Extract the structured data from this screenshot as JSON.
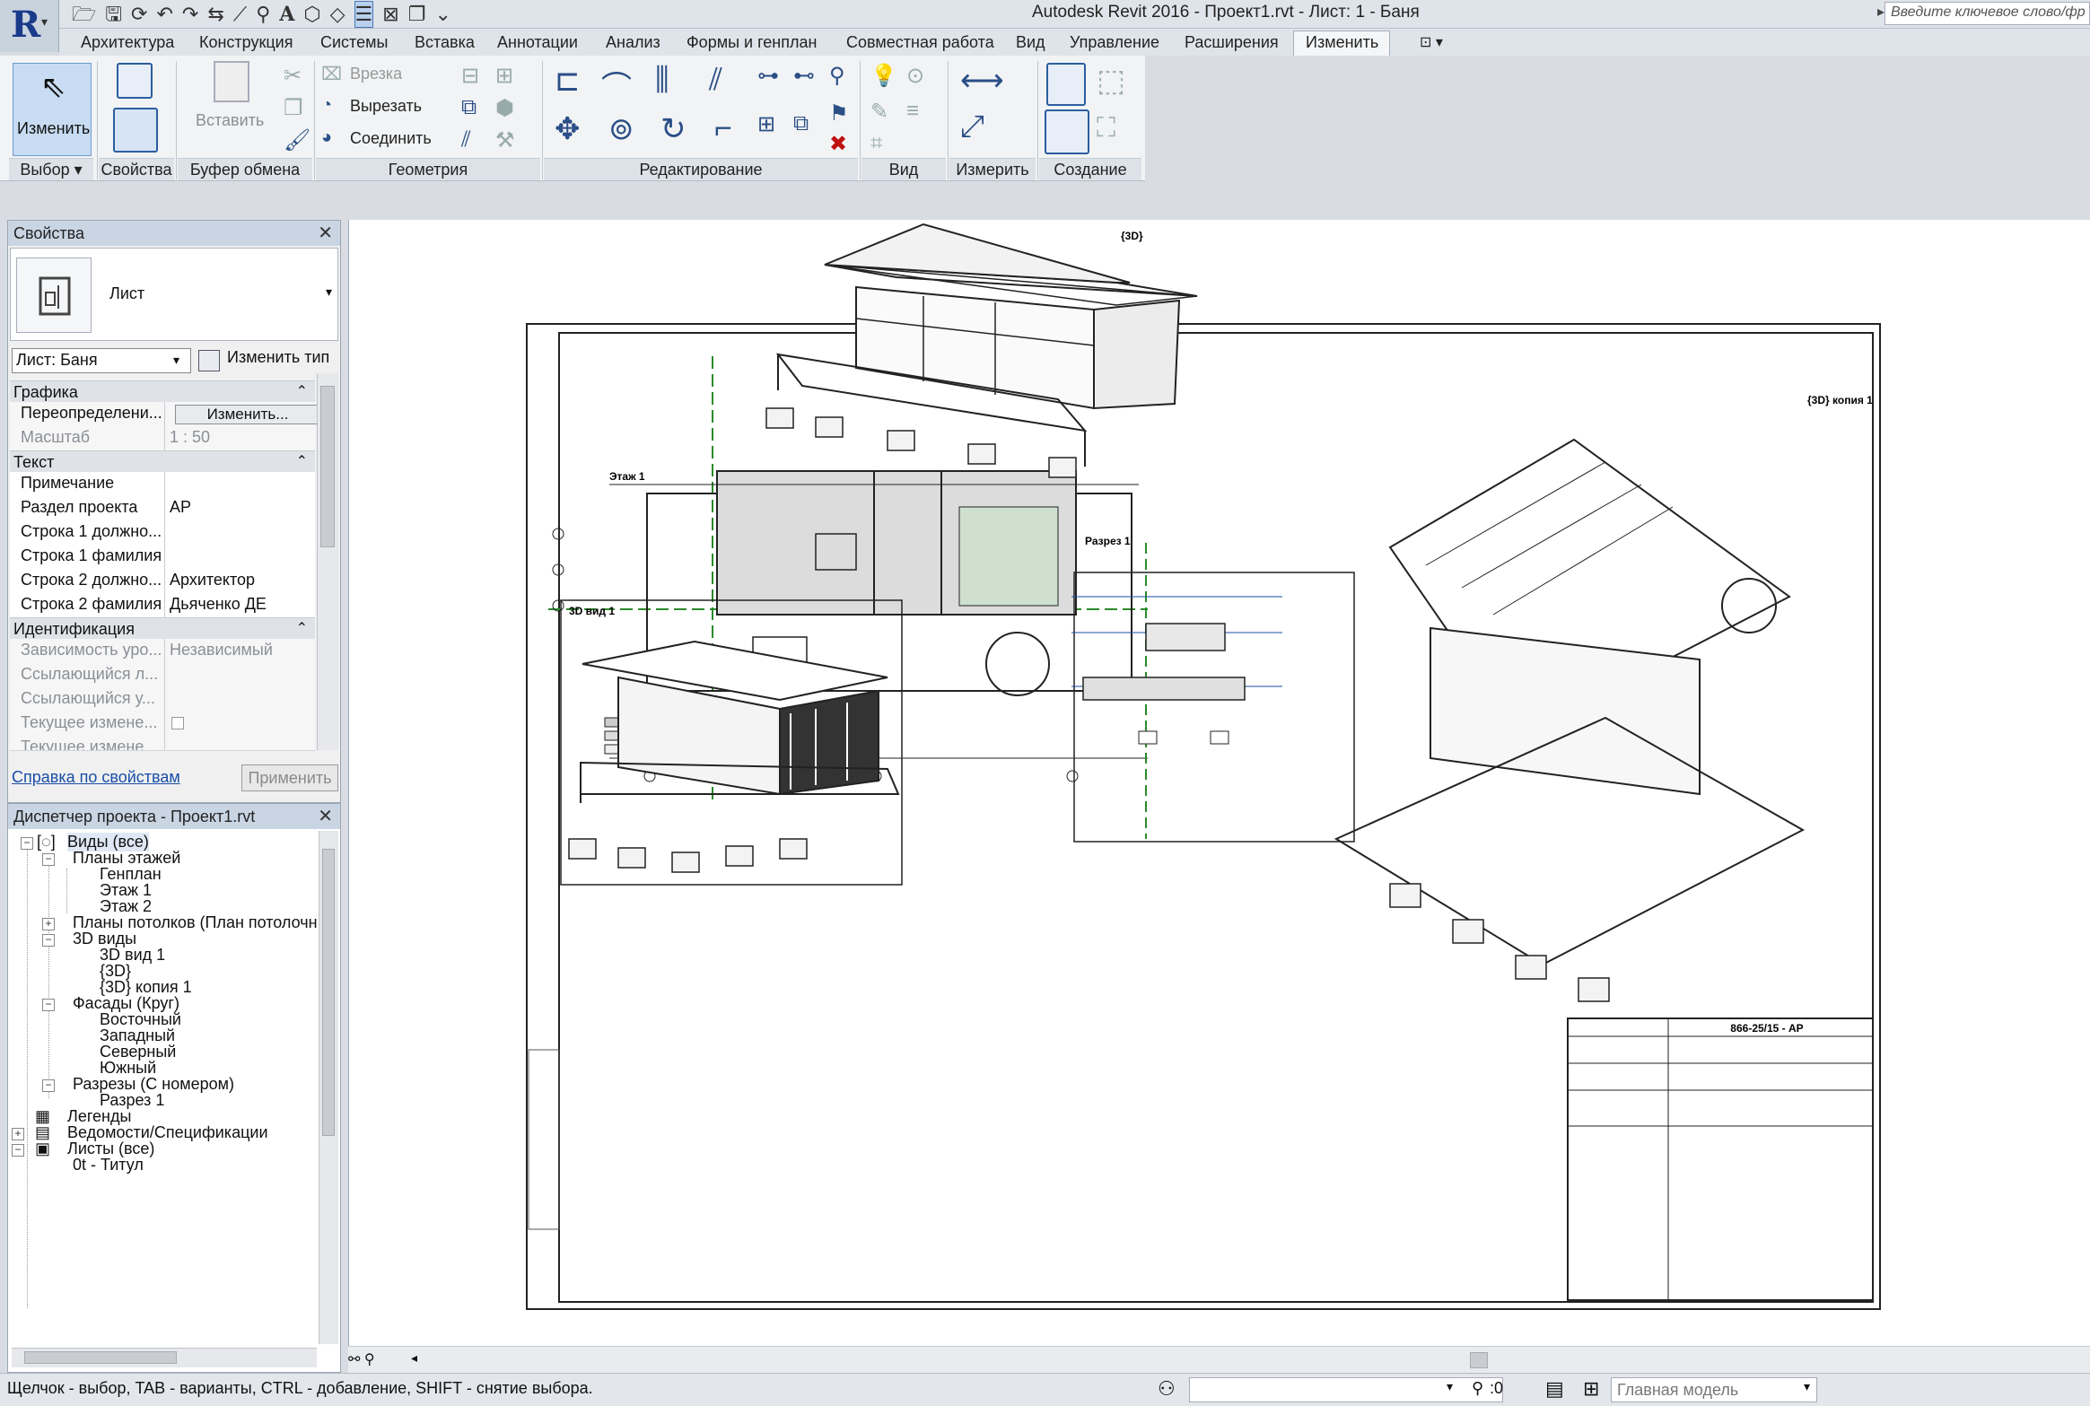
{
  "window": {
    "title": "Autodesk Revit 2016 -    Проект1.rvt - Лист: 1 - Баня"
  },
  "search": {
    "placeholder": "Введите ключевое слово/фр"
  },
  "tabs": [
    "Архитектура",
    "Конструкция",
    "Системы",
    "Вставка",
    "Аннотации",
    "Анализ",
    "Формы и генплан",
    "Совместная работа",
    "Вид",
    "Управление",
    "Расширения",
    "Изменить"
  ],
  "ribbon": {
    "modify_label": "Изменить",
    "paste_label": "Вставить",
    "cut_label": "Врезка",
    "cut2_label": "Вырезать",
    "join_label": "Соединить",
    "panels": [
      "Выбор",
      "Свойства",
      "Буфер обмена",
      "Геометрия",
      "Редактирование",
      "Вид",
      "Измерить",
      "Создание"
    ]
  },
  "properties": {
    "title": "Свойства",
    "type_name": "Лист",
    "instance_selector": "Лист: Баня",
    "edit_type": "Изменить тип",
    "groups": [
      "Графика",
      "Текст",
      "Идентификация"
    ],
    "graphics": [
      {
        "name": "Переопределени...",
        "value": "Изменить..."
      },
      {
        "name": "Масштаб",
        "value": "1 : 50"
      }
    ],
    "text": [
      {
        "name": "Примечание",
        "value": ""
      },
      {
        "name": "Раздел проекта",
        "value": "АР"
      },
      {
        "name": "Строка 1 должно...",
        "value": ""
      },
      {
        "name": "Строка 1 фамилия",
        "value": ""
      },
      {
        "name": "Строка 2 должно...",
        "value": "Архитектор"
      },
      {
        "name": "Строка 2 фамилия",
        "value": "Дьяченко ДЕ"
      }
    ],
    "identity": [
      {
        "name": "Зависимость уро...",
        "value": "Независимый"
      },
      {
        "name": "Ссылающийся л...",
        "value": ""
      },
      {
        "name": "Ссылающийся у...",
        "value": ""
      },
      {
        "name": "Текущее измене...",
        "value": ""
      },
      {
        "name": "Текущее измене...",
        "value": ""
      }
    ],
    "help_link": "Справка по свойствам",
    "apply": "Применить"
  },
  "browser": {
    "title": "Диспетчер проекта - Проект1.rvt",
    "items": [
      "Виды (все)",
      "Планы этажей",
      "Генплан",
      "Этаж 1",
      "Этаж 2",
      "Планы потолков (План потолочн",
      "3D виды",
      "3D вид 1",
      "{3D}",
      "{3D} копия 1",
      "Фасады (Круг)",
      "Восточный",
      "Западный",
      "Северный",
      "Южный",
      "Разрезы (С номером)",
      "Разрез 1",
      "Легенды",
      "Ведомости/Спецификации",
      "Листы (все)",
      "0t - Титул"
    ]
  },
  "sheet": {
    "labels": [
      "Этаж 1",
      "{3D}",
      "{3D} копия 1",
      "Разрез 1",
      "3D вид 1"
    ],
    "stamp_code": "866-25/15 - АР"
  },
  "status": {
    "hint": "Щелчок - выбор, TAB - варианты, CTRL - добавление, SHIFT - снятие выбора.",
    "zero": ":0",
    "model": "Главная модель"
  },
  "colors": {
    "accent": "#2b5e9e",
    "panel_header": "#c9d5e3",
    "link": "#1a4ea8"
  }
}
